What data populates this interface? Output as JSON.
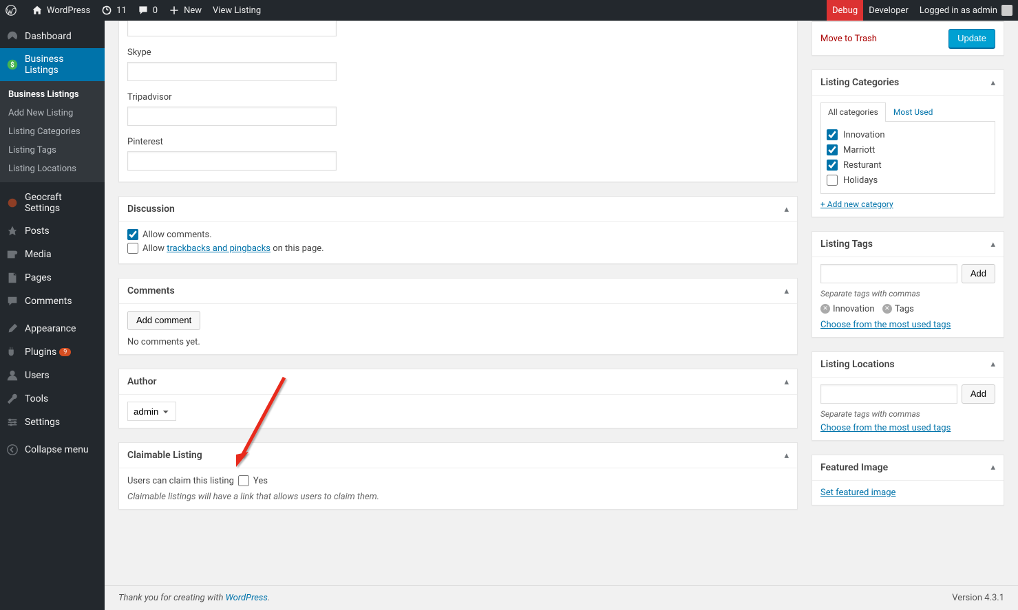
{
  "adminbar": {
    "site_name": "WordPress",
    "updates": "11",
    "comments": "0",
    "new": "New",
    "view_listing": "View Listing",
    "debug": "Debug",
    "developer": "Developer",
    "logged_in": "Logged in as admin"
  },
  "sidebar": {
    "dashboard": "Dashboard",
    "business_listings": "Business Listings",
    "submenu": {
      "business_listings": "Business Listings",
      "add_new": "Add New Listing",
      "categories": "Listing Categories",
      "tags": "Listing Tags",
      "locations": "Listing Locations"
    },
    "geocraft": "Geocraft Settings",
    "posts": "Posts",
    "media": "Media",
    "pages": "Pages",
    "comments": "Comments",
    "appearance": "Appearance",
    "plugins": "Plugins",
    "plugins_count": "9",
    "users": "Users",
    "tools": "Tools",
    "settings": "Settings",
    "collapse": "Collapse menu"
  },
  "social": {
    "skype": "Skype",
    "tripadvisor": "Tripadvisor",
    "pinterest": "Pinterest"
  },
  "discussion": {
    "title": "Discussion",
    "allow_comments": "Allow comments.",
    "allow_trackbacks_pre": "Allow ",
    "allow_trackbacks_link": "trackbacks and pingbacks",
    "allow_trackbacks_post": " on this page."
  },
  "comments_box": {
    "title": "Comments",
    "add_comment": "Add comment",
    "none": "No comments yet."
  },
  "author": {
    "title": "Author",
    "value": "admin"
  },
  "claimable": {
    "title": "Claimable Listing",
    "label": "Users can claim this listing",
    "yes": "Yes",
    "desc": "Claimable listings will have a link that allows users to claim them."
  },
  "publish": {
    "trash": "Move to Trash",
    "update": "Update"
  },
  "categories": {
    "title": "Listing Categories",
    "tab_all": "All categories",
    "tab_most": "Most Used",
    "items": [
      "Innovation",
      "Marriott",
      "Resturant",
      "Holidays"
    ],
    "add_new": "+ Add new category"
  },
  "tags": {
    "title": "Listing Tags",
    "add": "Add",
    "hint": "Separate tags with commas",
    "items": [
      "Innovation",
      "Tags"
    ],
    "choose": "Choose from the most used tags"
  },
  "locations": {
    "title": "Listing Locations",
    "add": "Add",
    "hint": "Separate tags with commas",
    "choose": "Choose from the most used tags"
  },
  "featured": {
    "title": "Featured Image",
    "set": "Set featured image"
  },
  "footer": {
    "thanks": "Thank you for creating with ",
    "wp": "WordPress",
    "version": "Version 4.3.1"
  }
}
